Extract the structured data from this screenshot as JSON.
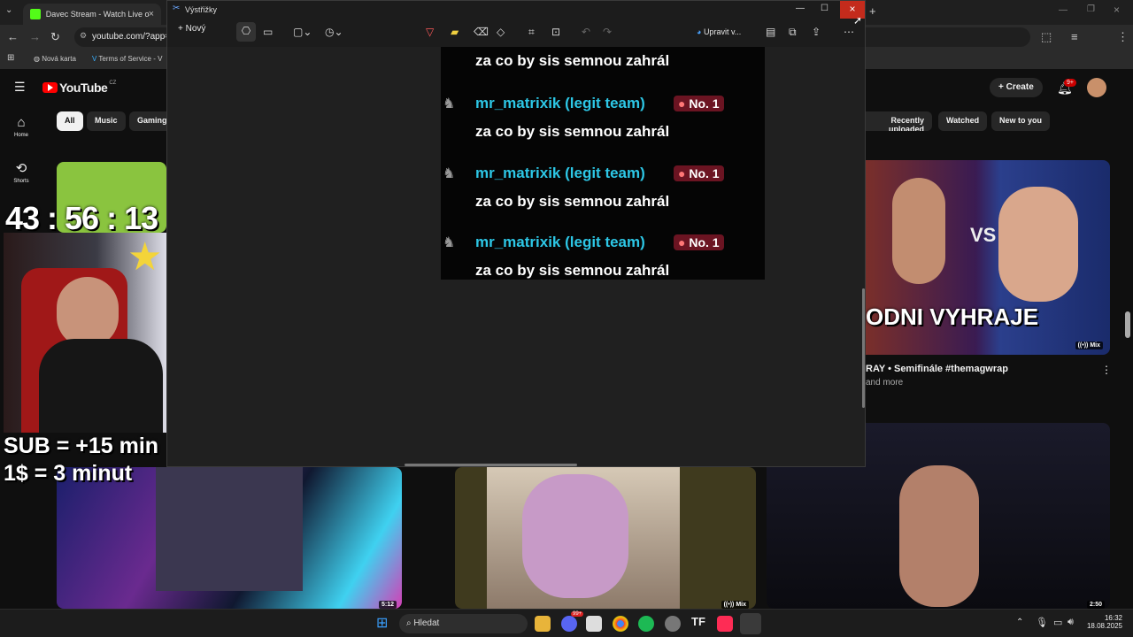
{
  "browser": {
    "tab_title": "Davec Stream - Watch Live on K",
    "url": "youtube.com/?app=",
    "bookmarks": [
      "Nová karta",
      "Terms of Service - V"
    ]
  },
  "youtube": {
    "logo_text": "YouTube",
    "region": "CZ",
    "create_label": "Create",
    "notifications": "9+",
    "chips": [
      "All",
      "Music",
      "Gaming",
      "Recently uploaded",
      "Watched",
      "New to you"
    ],
    "sidebar": [
      {
        "label": "Home",
        "icon": "home-icon"
      },
      {
        "label": "Shorts",
        "icon": "shorts-icon"
      }
    ],
    "videos": [
      {
        "title": "RAY • Semifinále #themagwrap",
        "meta": "and more",
        "overlay": "ODNI VYHRAJE",
        "badge": "Mix"
      },
      {
        "duration": "5:12"
      },
      {
        "badge": "Mix"
      },
      {
        "duration": "2:50"
      }
    ]
  },
  "snipping": {
    "title": "Výstřižky",
    "new_label": "Nový",
    "edit_label": "Upravit v...",
    "chat": [
      {
        "user": "mr_matrixik (legit team)",
        "badge": "No. 1",
        "text": "za co by sis semnou zahrál"
      },
      {
        "user": "mr_matrixik (legit team)",
        "badge": "No. 1",
        "text": "za co by sis semnou zahrál"
      },
      {
        "user": "mr_matrixik (legit team)",
        "badge": "No. 1",
        "text": "za co by sis semnou zahrál"
      }
    ],
    "chat_top_text": "za co by sis semnou zahrál"
  },
  "stream_overlay": {
    "timer": "43 : 56 : 13",
    "sub_rule": "SUB = +15 min",
    "dollar_rule": "1$ = 3 minut"
  },
  "taskbar": {
    "search_placeholder": "Hledat",
    "time": "16:32",
    "date": "18.08.2025",
    "discord_badge": "99+"
  }
}
